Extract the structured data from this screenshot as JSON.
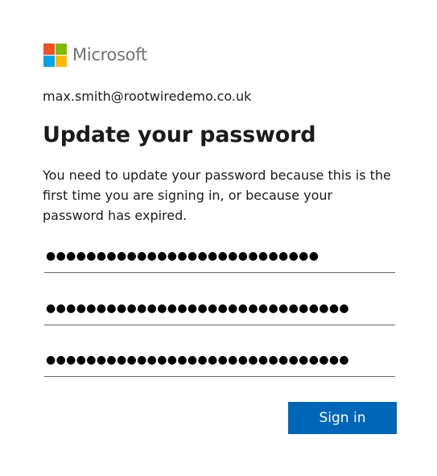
{
  "brand": {
    "name": "Microsoft",
    "logo_colors": [
      "#f25022",
      "#7fba00",
      "#00a4ef",
      "#ffb900"
    ],
    "word_color": "#737373"
  },
  "account": {
    "email": "max.smith@rootwiredemo.co.uk"
  },
  "heading": "Update your password",
  "description": "You need to update your password because this is the first time you are signing in, or because your password has expired.",
  "fields": [
    {
      "name": "current-password",
      "masked_value": "●●●●●●●●●●●●●●●●●●●●●●●●●●●"
    },
    {
      "name": "new-password",
      "masked_value": "●●●●●●●●●●●●●●●●●●●●●●●●●●●●●●"
    },
    {
      "name": "confirm-password",
      "masked_value": "●●●●●●●●●●●●●●●●●●●●●●●●●●●●●●"
    }
  ],
  "submit": {
    "label": "Sign in",
    "color": "#0067b8"
  }
}
